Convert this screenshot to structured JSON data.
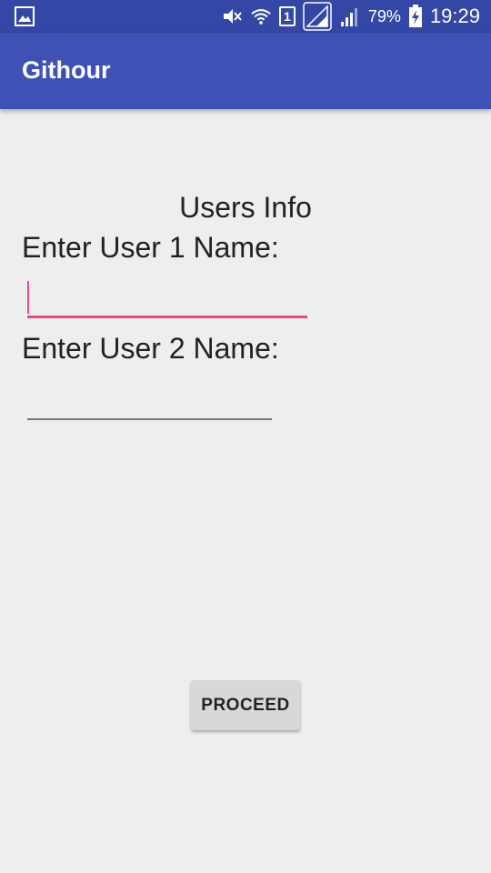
{
  "status_bar": {
    "battery_percent": "79%",
    "time": "19:29",
    "sim_slot": "1",
    "icons": [
      "image-notification-icon",
      "mute-icon",
      "wifi-icon",
      "sim-icon",
      "signal-1-icon",
      "signal-2-icon",
      "battery-charging-icon"
    ]
  },
  "app_bar": {
    "title": "Githour"
  },
  "form": {
    "section_title": "Users Info",
    "user1_label": "Enter User 1 Name:",
    "user1_value": "",
    "user2_label": "Enter User 2 Name:",
    "user2_value": "",
    "proceed_label": "PROCEED"
  },
  "colors": {
    "status_bar": "#3447a6",
    "app_bar": "#3f51b5",
    "accent": "#e94b7c",
    "background": "#eeeeee"
  }
}
